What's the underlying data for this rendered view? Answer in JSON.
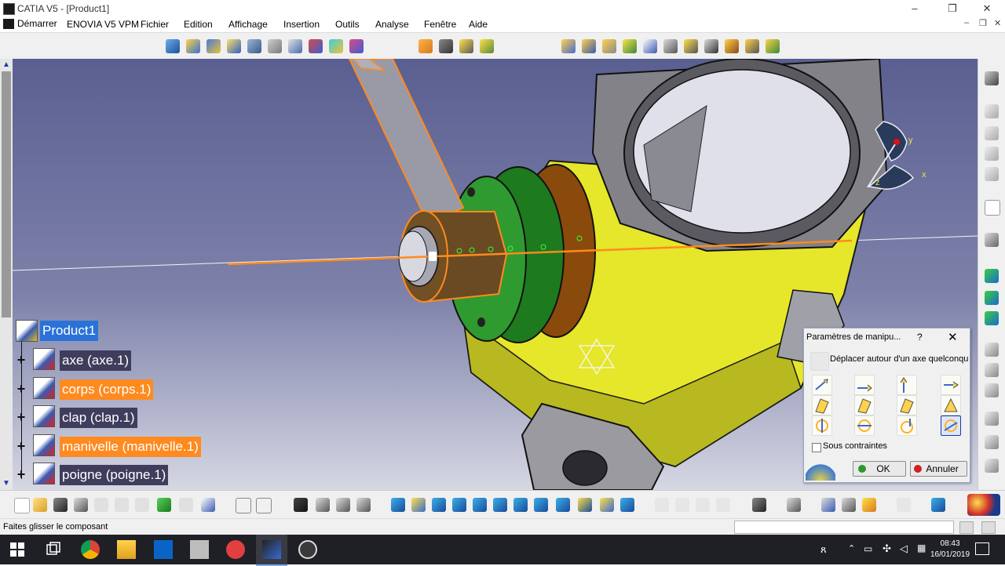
{
  "window": {
    "title": "CATIA V5 - [Product1]",
    "controls": {
      "minimize": "–",
      "maximize": "❐",
      "close": "✕"
    },
    "inner_controls": {
      "minimize": "–",
      "restore": "❐",
      "close": "✕"
    }
  },
  "menubar": {
    "start": "Démarrer",
    "items": [
      "ENOVIA V5 VPM",
      "Fichier",
      "Edition",
      "Affichage",
      "Insertion",
      "Outils",
      "Analyse",
      "Fenêtre",
      "Aide"
    ]
  },
  "tree": {
    "root": "Product1",
    "children": [
      {
        "label": "axe (axe.1)",
        "highlighted": false
      },
      {
        "label": "corps (corps.1)",
        "highlighted": true
      },
      {
        "label": "clap (clap.1)",
        "highlighted": false
      },
      {
        "label": "manivelle (manivelle.1)",
        "highlighted": true
      },
      {
        "label": "poigne (poigne.1)",
        "highlighted": false
      }
    ]
  },
  "compass": {
    "x_label": "x",
    "y_label": "y",
    "z_label": "z"
  },
  "dialog": {
    "title": "Paramètres de manipu...",
    "help": "?",
    "close": "✕",
    "mode_text": "Déplacer autour d'un axe quelconque",
    "grid_icons": [
      "translate-x-icon",
      "translate-y-icon",
      "translate-z-icon",
      "translate-along-axis-icon",
      "translate-xy-plane-icon",
      "translate-yz-plane-icon",
      "translate-xz-plane-icon",
      "translate-in-plane-icon",
      "rotate-x-icon",
      "rotate-y-icon",
      "rotate-z-icon",
      "rotate-around-axis-icon"
    ],
    "constraints_label": "Sous contraintes",
    "constraints_checked": false,
    "ok_label": "OK",
    "cancel_label": "Annuler"
  },
  "status": {
    "message": "Faites glisser le composant",
    "command_value": ""
  },
  "taskbar": {
    "apps": [
      "windows-start-icon",
      "task-view-icon",
      "chrome-icon",
      "file-explorer-icon",
      "outlook-icon",
      "drive-icon",
      "no-entry-icon",
      "catia-icon",
      "obs-icon"
    ],
    "time": "08:43",
    "date": "16/01/2019"
  },
  "colors": {
    "viewport_top": "#5a5f91",
    "selection_orange": "#ff8a1f",
    "tree_root_blue": "#2a72d8",
    "tree_label_bg": "#3f3d5c",
    "body_yellow": "#e6e62a",
    "disk_green": "#1e7a1e",
    "axis_orange": "#ff8a1f"
  }
}
